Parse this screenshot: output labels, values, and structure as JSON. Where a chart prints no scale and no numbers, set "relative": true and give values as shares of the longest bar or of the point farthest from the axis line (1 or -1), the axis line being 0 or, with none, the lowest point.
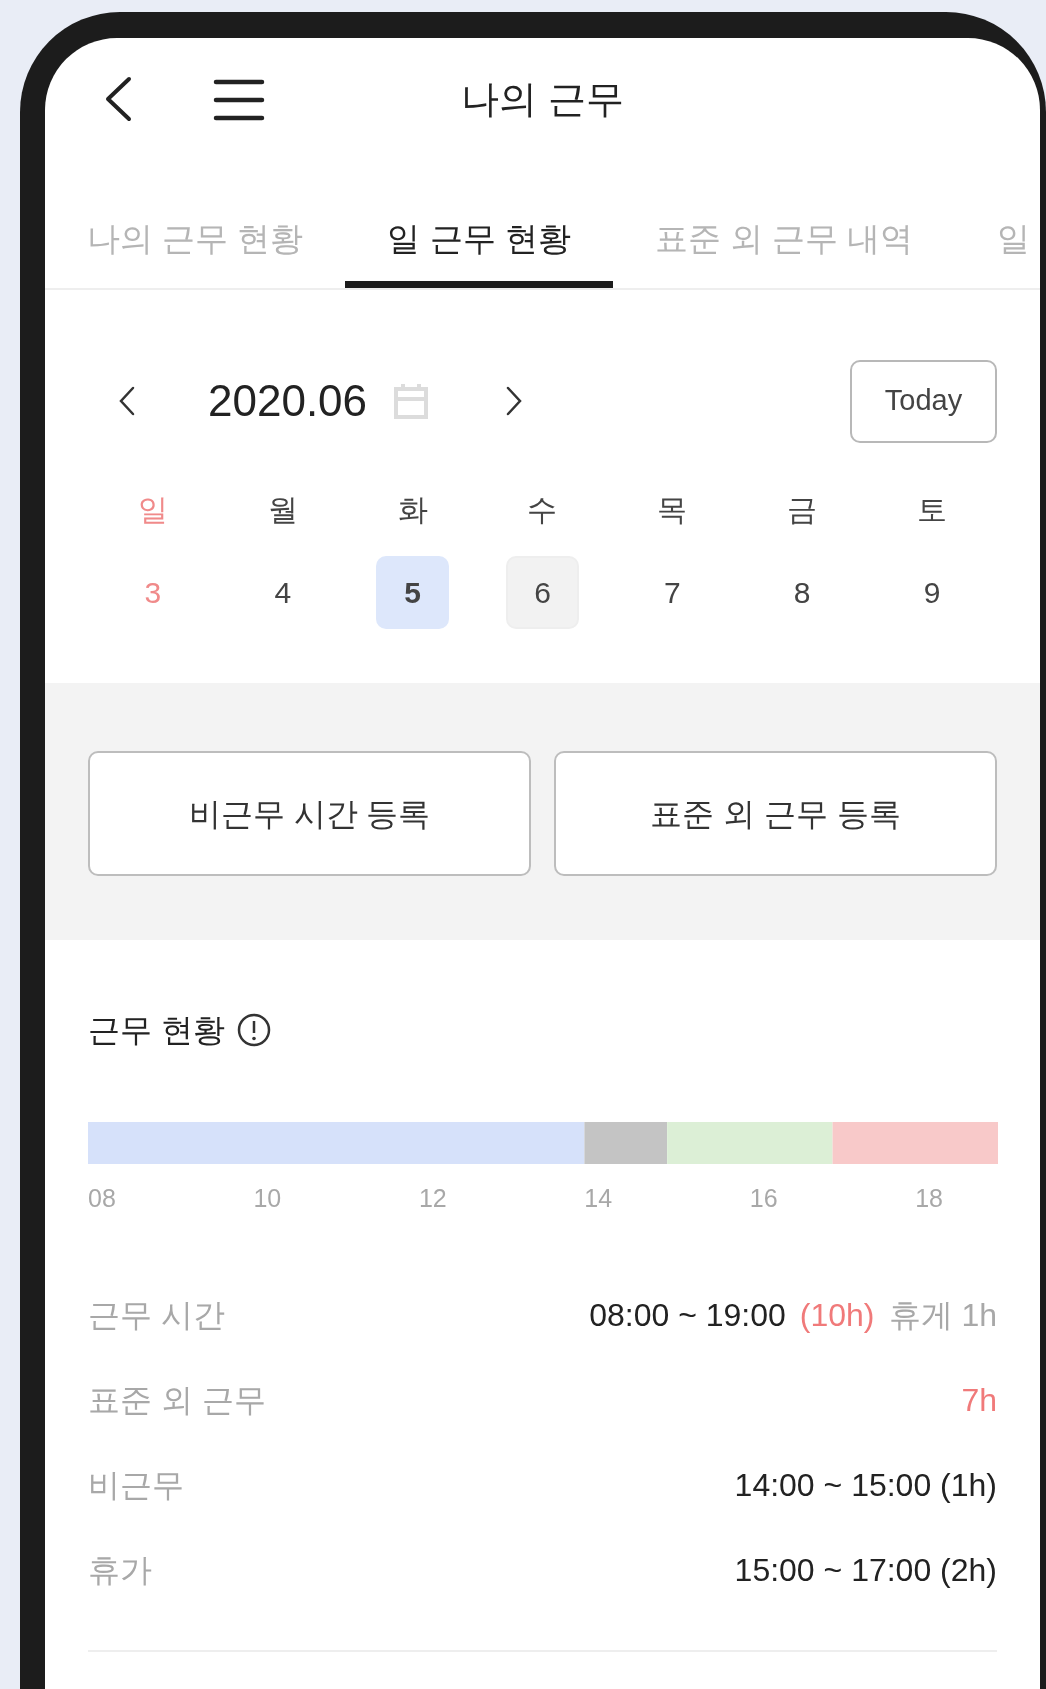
{
  "header": {
    "title": "나의 근무"
  },
  "tabs": [
    {
      "label": "나의 근무 현황",
      "selected": false
    },
    {
      "label": "일 근무 현황",
      "selected": true
    },
    {
      "label": "표준 외 근무 내역",
      "selected": false
    },
    {
      "label": "일",
      "selected": false
    }
  ],
  "calendar": {
    "month": "2020.06",
    "today_button": "Today",
    "weekdays": [
      {
        "label": "일",
        "holiday": true
      },
      {
        "label": "월",
        "holiday": false
      },
      {
        "label": "화",
        "holiday": false
      },
      {
        "label": "수",
        "holiday": false
      },
      {
        "label": "목",
        "holiday": false
      },
      {
        "label": "금",
        "holiday": false
      },
      {
        "label": "토",
        "holiday": false
      }
    ],
    "days": [
      {
        "label": "3",
        "holiday": true,
        "selected": false,
        "highlighted": false
      },
      {
        "label": "4",
        "holiday": false,
        "selected": false,
        "highlighted": false
      },
      {
        "label": "5",
        "holiday": false,
        "selected": true,
        "highlighted": false
      },
      {
        "label": "6",
        "holiday": false,
        "selected": false,
        "highlighted": true
      },
      {
        "label": "7",
        "holiday": false,
        "selected": false,
        "highlighted": false
      },
      {
        "label": "8",
        "holiday": false,
        "selected": false,
        "highlighted": false
      },
      {
        "label": "9",
        "holiday": false,
        "selected": false,
        "highlighted": false
      }
    ]
  },
  "actions": [
    "비근무 시간 등록",
    "표준 외 근무 등록"
  ],
  "status": {
    "title": "근무 현황",
    "chart_data": {
      "type": "bar",
      "orientation": "horizontal",
      "stacked": true,
      "relative": true,
      "series": [
        {
          "color": "#d6e1fa",
          "values": [
            0.5455
          ]
        },
        {
          "color": "#c4c4c4",
          "values": [
            0.0909
          ]
        },
        {
          "color": "#dcefd6",
          "values": [
            0.1818
          ]
        },
        {
          "color": "#f8c9c9",
          "values": [
            0.1818
          ]
        }
      ]
    },
    "hour_labels": [
      "08",
      "10",
      "12",
      "14",
      "16",
      "18"
    ],
    "rows": [
      {
        "label": "근무 시간",
        "parts": [
          {
            "text": "08:00 ~ 19:00",
            "kind": "normal"
          },
          {
            "text": "(10h)",
            "kind": "alert"
          },
          {
            "text": "휴게 1h",
            "kind": "muted"
          }
        ]
      },
      {
        "label": "표준 외 근무",
        "parts": [
          {
            "text": "7h",
            "kind": "alert"
          }
        ]
      },
      {
        "label": "비근무",
        "parts": [
          {
            "text": "14:00 ~ 15:00 (1h)",
            "kind": "normal"
          }
        ]
      },
      {
        "label": "휴가",
        "parts": [
          {
            "text": "15:00 ~ 17:00 (2h)",
            "kind": "normal"
          }
        ]
      }
    ]
  }
}
